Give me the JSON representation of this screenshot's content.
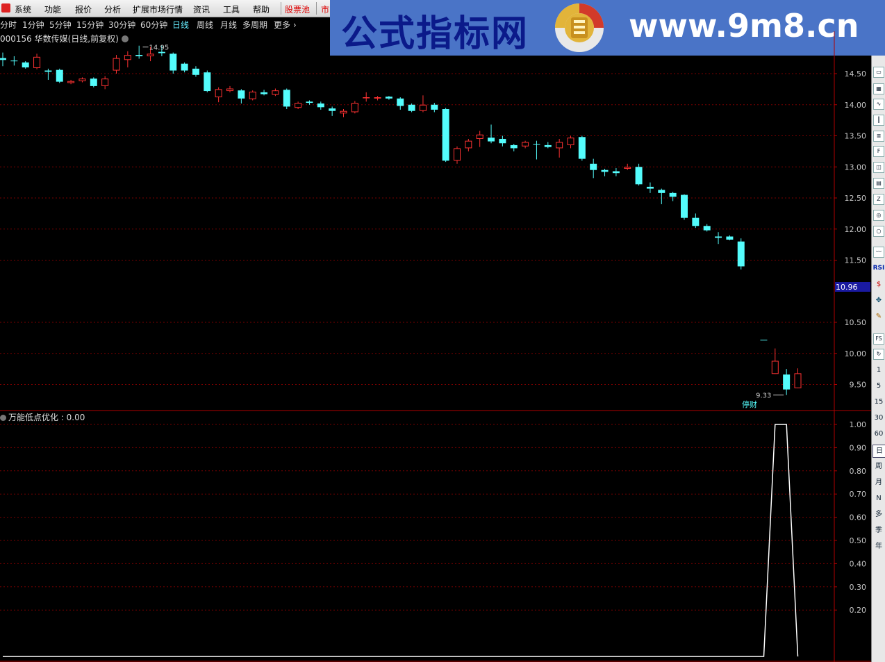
{
  "menubar": {
    "items": [
      "系统",
      "功能",
      "报价",
      "分析",
      "扩展市场行情",
      "资讯",
      "工具",
      "帮助",
      "股票池",
      "市"
    ]
  },
  "banner": {
    "title": "公式指标网",
    "url": "www.9m8.cn",
    "seal_text": "www.9m8.cn"
  },
  "period_bar": {
    "items": [
      "分时",
      "1分钟",
      "5分钟",
      "15分钟",
      "30分钟",
      "60分钟",
      "日线",
      "周线",
      "月线",
      "多周期",
      "更多"
    ],
    "active": "日线"
  },
  "stock": {
    "title": "000156 华数传媒(日线,前复权)"
  },
  "indicator": {
    "title": "万能低点优化 : 0.00"
  },
  "right_toolbar": {
    "items": [
      "RSI",
      "FS",
      "1",
      "5",
      "15",
      "30",
      "60",
      "日",
      "周",
      "月",
      "N",
      "多",
      "季",
      "年"
    ],
    "active": "日"
  },
  "colors": {
    "up": "#ff3232",
    "down": "#54fcfc",
    "grid": "#7a0000",
    "axis": "#b00000",
    "label": "#c8c8c8",
    "current_bg": "#1a1aa0"
  },
  "chart_data": [
    {
      "type": "candlestick",
      "title": "000156 华数传媒(日线,前复权)",
      "ylim": [
        9.3,
        15.0
      ],
      "y_ticks": [
        14.5,
        14.0,
        13.5,
        13.0,
        12.5,
        12.0,
        11.5,
        10.5,
        10.0,
        9.5
      ],
      "y_tick_labels": [
        "14.50",
        "14.00",
        "13.50",
        "13.00",
        "12.50",
        "12.00",
        "11.50",
        "10.50",
        "10.00",
        "9.50"
      ],
      "current_price": "10.96",
      "max_label": "14.95",
      "min_label": "9.33",
      "annotation": "停财",
      "candles": [
        {
          "o": 14.75,
          "c": 14.72,
          "h": 14.84,
          "l": 14.62
        },
        {
          "o": 14.71,
          "c": 14.7,
          "h": 14.78,
          "l": 14.63
        },
        {
          "o": 14.68,
          "c": 14.6,
          "h": 14.7,
          "l": 14.58
        },
        {
          "o": 14.59,
          "c": 14.77,
          "h": 14.82,
          "l": 14.57
        },
        {
          "o": 14.55,
          "c": 14.53,
          "h": 14.58,
          "l": 14.4
        },
        {
          "o": 14.56,
          "c": 14.37,
          "h": 14.58,
          "l": 14.35
        },
        {
          "o": 14.35,
          "c": 14.38,
          "h": 14.4,
          "l": 14.33
        },
        {
          "o": 14.38,
          "c": 14.42,
          "h": 14.44,
          "l": 14.36
        },
        {
          "o": 14.42,
          "c": 14.3,
          "h": 14.44,
          "l": 14.28
        },
        {
          "o": 14.3,
          "c": 14.42,
          "h": 14.46,
          "l": 14.25
        },
        {
          "o": 14.55,
          "c": 14.75,
          "h": 14.8,
          "l": 14.5
        },
        {
          "o": 14.72,
          "c": 14.8,
          "h": 14.86,
          "l": 14.6
        },
        {
          "o": 14.8,
          "c": 14.78,
          "h": 14.95,
          "l": 14.74
        },
        {
          "o": 14.78,
          "c": 14.82,
          "h": 14.93,
          "l": 14.7
        },
        {
          "o": 14.85,
          "c": 14.83,
          "h": 14.95,
          "l": 14.78
        },
        {
          "o": 14.82,
          "c": 14.55,
          "h": 14.84,
          "l": 14.5
        },
        {
          "o": 14.66,
          "c": 14.55,
          "h": 14.68,
          "l": 14.52
        },
        {
          "o": 14.58,
          "c": 14.48,
          "h": 14.62,
          "l": 14.45
        },
        {
          "o": 14.52,
          "c": 14.22,
          "h": 14.55,
          "l": 14.2
        },
        {
          "o": 14.12,
          "c": 14.25,
          "h": 14.28,
          "l": 14.04
        },
        {
          "o": 14.22,
          "c": 14.26,
          "h": 14.3,
          "l": 14.2
        },
        {
          "o": 14.23,
          "c": 14.1,
          "h": 14.25,
          "l": 14.02
        },
        {
          "o": 14.09,
          "c": 14.21,
          "h": 14.23,
          "l": 14.07
        },
        {
          "o": 14.2,
          "c": 14.17,
          "h": 14.24,
          "l": 14.15
        },
        {
          "o": 14.16,
          "c": 14.23,
          "h": 14.26,
          "l": 14.14
        },
        {
          "o": 14.24,
          "c": 13.97,
          "h": 14.26,
          "l": 13.93
        },
        {
          "o": 13.95,
          "c": 14.03,
          "h": 14.05,
          "l": 13.93
        },
        {
          "o": 14.05,
          "c": 14.03,
          "h": 14.07,
          "l": 14.0
        },
        {
          "o": 14.02,
          "c": 13.96,
          "h": 14.05,
          "l": 13.92
        },
        {
          "o": 13.94,
          "c": 13.9,
          "h": 13.97,
          "l": 13.82
        },
        {
          "o": 13.86,
          "c": 13.9,
          "h": 13.93,
          "l": 13.8
        },
        {
          "o": 13.88,
          "c": 14.03,
          "h": 14.06,
          "l": 13.86
        },
        {
          "o": 14.11,
          "c": 14.12,
          "h": 14.2,
          "l": 14.05
        },
        {
          "o": 14.1,
          "c": 14.12,
          "h": 14.14,
          "l": 14.07
        },
        {
          "o": 14.13,
          "c": 14.1,
          "h": 14.14,
          "l": 14.08
        },
        {
          "o": 14.1,
          "c": 13.98,
          "h": 14.12,
          "l": 13.92
        },
        {
          "o": 14.0,
          "c": 13.9,
          "h": 14.02,
          "l": 13.88
        },
        {
          "o": 13.9,
          "c": 14.0,
          "h": 14.15,
          "l": 13.88
        },
        {
          "o": 14.0,
          "c": 13.92,
          "h": 14.03,
          "l": 13.88
        },
        {
          "o": 13.93,
          "c": 13.1,
          "h": 13.95,
          "l": 13.08
        },
        {
          "o": 13.1,
          "c": 13.3,
          "h": 13.33,
          "l": 13.05
        },
        {
          "o": 13.3,
          "c": 13.42,
          "h": 13.45,
          "l": 13.25
        },
        {
          "o": 13.45,
          "c": 13.52,
          "h": 13.58,
          "l": 13.32
        },
        {
          "o": 13.47,
          "c": 13.41,
          "h": 13.68,
          "l": 13.38
        },
        {
          "o": 13.45,
          "c": 13.38,
          "h": 13.5,
          "l": 13.33
        },
        {
          "o": 13.35,
          "c": 13.3,
          "h": 13.37,
          "l": 13.25
        },
        {
          "o": 13.33,
          "c": 13.4,
          "h": 13.42,
          "l": 13.3
        },
        {
          "o": 13.37,
          "c": 13.36,
          "h": 13.42,
          "l": 13.12
        },
        {
          "o": 13.35,
          "c": 13.32,
          "h": 13.4,
          "l": 13.3
        },
        {
          "o": 13.3,
          "c": 13.4,
          "h": 13.45,
          "l": 13.15
        },
        {
          "o": 13.35,
          "c": 13.47,
          "h": 13.5,
          "l": 13.3
        },
        {
          "o": 13.48,
          "c": 13.13,
          "h": 13.5,
          "l": 13.1
        },
        {
          "o": 13.05,
          "c": 12.95,
          "h": 13.13,
          "l": 12.82
        },
        {
          "o": 12.95,
          "c": 12.92,
          "h": 12.97,
          "l": 12.85
        },
        {
          "o": 12.93,
          "c": 12.9,
          "h": 12.98,
          "l": 12.85
        },
        {
          "o": 12.97,
          "c": 13.0,
          "h": 13.05,
          "l": 12.95
        },
        {
          "o": 13.0,
          "c": 12.72,
          "h": 13.05,
          "l": 12.7
        },
        {
          "o": 12.68,
          "c": 12.65,
          "h": 12.75,
          "l": 12.58
        },
        {
          "o": 12.63,
          "c": 12.58,
          "h": 12.65,
          "l": 12.4
        },
        {
          "o": 12.58,
          "c": 12.52,
          "h": 12.6,
          "l": 12.45
        },
        {
          "o": 12.55,
          "c": 12.18,
          "h": 12.56,
          "l": 12.15
        },
        {
          "o": 12.18,
          "c": 12.05,
          "h": 12.25,
          "l": 12.02
        },
        {
          "o": 12.05,
          "c": 11.98,
          "h": 12.08,
          "l": 11.96
        },
        {
          "o": 11.88,
          "c": 11.86,
          "h": 11.95,
          "l": 11.76
        },
        {
          "o": 11.88,
          "c": 11.83,
          "h": 11.9,
          "l": 11.82
        },
        {
          "o": 11.8,
          "c": 11.4,
          "h": 11.85,
          "l": 11.35
        },
        null,
        {
          "o": 10.22,
          "c": 10.22,
          "h": 10.22,
          "l": 10.22
        },
        {
          "o": 9.67,
          "c": 9.88,
          "h": 10.08,
          "l": 9.67
        },
        {
          "o": 9.66,
          "c": 9.42,
          "h": 9.75,
          "l": 9.33
        },
        {
          "o": 9.44,
          "c": 9.68,
          "h": 9.76,
          "l": 9.44
        }
      ]
    },
    {
      "type": "line",
      "title": "万能低点优化",
      "current_value": "0.00",
      "ylim": [
        0,
        1.05
      ],
      "y_ticks": [
        1.0,
        0.9,
        0.8,
        0.7,
        0.6,
        0.5,
        0.4,
        0.3,
        0.2
      ],
      "y_tick_labels": [
        "1.00",
        "0.90",
        "0.80",
        "0.70",
        "0.60",
        "0.50",
        "0.40",
        "0.30",
        "0.20"
      ],
      "values": [
        0,
        0,
        0,
        0,
        0,
        0,
        0,
        0,
        0,
        0,
        0,
        0,
        0,
        0,
        0,
        0,
        0,
        0,
        0,
        0,
        0,
        0,
        0,
        0,
        0,
        0,
        0,
        0,
        0,
        0,
        0,
        0,
        0,
        0,
        0,
        0,
        0,
        0,
        0,
        0,
        0,
        0,
        0,
        0,
        0,
        0,
        0,
        0,
        0,
        0,
        0,
        0,
        0,
        0,
        0,
        0,
        0,
        0,
        0,
        0,
        0,
        0,
        0,
        0,
        0,
        0,
        0,
        0,
        1,
        1,
        0
      ]
    }
  ]
}
